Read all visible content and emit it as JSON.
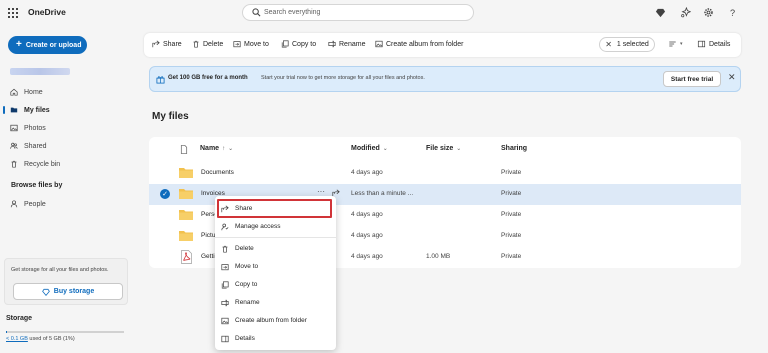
{
  "app": {
    "title": "OneDrive"
  },
  "search": {
    "placeholder": "Search everything"
  },
  "topbar_icons": [
    "diamond-icon",
    "sparkle-icon",
    "gear-icon",
    "help-icon"
  ],
  "sidebar": {
    "create_label": "Create or upload",
    "items": [
      {
        "label": "Home",
        "icon": "home-icon"
      },
      {
        "label": "My files",
        "icon": "folder-icon",
        "selected": true
      },
      {
        "label": "Photos",
        "icon": "photo-icon"
      },
      {
        "label": "Shared",
        "icon": "people-icon"
      },
      {
        "label": "Recycle bin",
        "icon": "trash-icon"
      }
    ],
    "browse_heading": "Browse files by",
    "browse_items": [
      {
        "label": "People",
        "icon": "person-icon"
      }
    ],
    "storage_promo": "Get storage for all your files and photos.",
    "buy_storage": "Buy storage",
    "storage_heading": "Storage",
    "storage_used_link": "< 0.1 GB",
    "storage_used_rest": " used of 5 GB (1%)",
    "storage_fraction": 0.01
  },
  "commandbar": {
    "share": "Share",
    "delete": "Delete",
    "move_to": "Move to",
    "copy_to": "Copy to",
    "rename": "Rename",
    "create_album": "Create album from folder",
    "selected": "1 selected",
    "details": "Details"
  },
  "banner": {
    "main": "Get 100 GB free for a month",
    "sub": "Start your trial now to get more storage for all your files and photos.",
    "button": "Start free trial"
  },
  "main": {
    "heading": "My files",
    "columns": {
      "name": "Name",
      "modified": "Modified",
      "size": "File size",
      "sharing": "Sharing"
    },
    "rows": [
      {
        "name": "Documents",
        "modified": "4 days ago",
        "size": "",
        "sharing": "Private",
        "type": "folder"
      },
      {
        "name": "Invoices",
        "modified": "Less than a minute ...",
        "size": "",
        "sharing": "Private",
        "type": "folder",
        "selected": true
      },
      {
        "name": "Perso",
        "modified": "4 days ago",
        "size": "",
        "sharing": "Private",
        "type": "folder"
      },
      {
        "name": "Pictu",
        "modified": "4 days ago",
        "size": "",
        "sharing": "Private",
        "type": "folder"
      },
      {
        "name": "Getti",
        "modified": "4 days ago",
        "size": "1.00 MB",
        "sharing": "Private",
        "type": "pdf"
      }
    ]
  },
  "context_menu": {
    "items": [
      {
        "label": "Share",
        "icon": "share-icon",
        "highlighted": true
      },
      {
        "label": "Manage access",
        "icon": "manage-access-icon"
      },
      {
        "label": "Delete",
        "icon": "trash-icon"
      },
      {
        "label": "Move to",
        "icon": "move-icon"
      },
      {
        "label": "Copy to",
        "icon": "copy-icon"
      },
      {
        "label": "Rename",
        "icon": "rename-icon"
      },
      {
        "label": "Create album from folder",
        "icon": "album-icon"
      },
      {
        "label": "Details",
        "icon": "details-icon"
      }
    ]
  },
  "colors": {
    "accent": "#0f6cbd",
    "banner_bg": "#dcecfb",
    "selection_bg": "#dde9f7",
    "highlight_border": "#d13438",
    "folder": "#f2c14e"
  }
}
